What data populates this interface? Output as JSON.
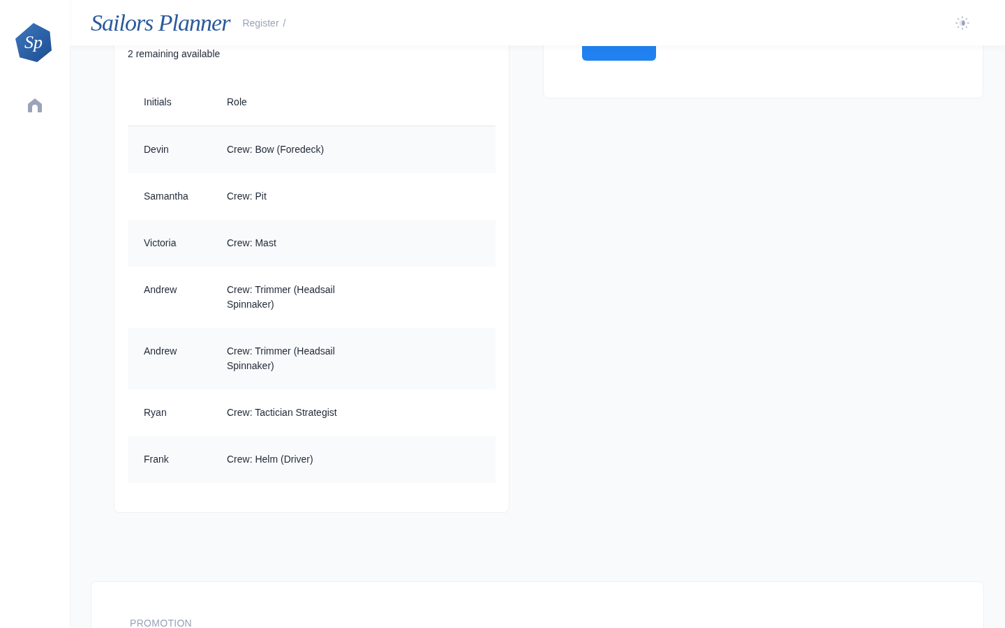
{
  "sidebar": {
    "logo": "Sp",
    "items": [
      {
        "kind": "home",
        "selected": false
      }
    ]
  },
  "header": {
    "brand": "Sailors Planner",
    "breadcrumb": [
      {
        "label": "Register",
        "separator": "/"
      }
    ]
  },
  "crew_card": {
    "remaining": "2 remaining available",
    "table": {
      "columns": [
        "Initials",
        "Role"
      ],
      "rows": [
        [
          "Devin",
          "Crew: Bow (Foredeck)"
        ],
        [
          "Samantha",
          "Crew: Pit"
        ],
        [
          "Victoria",
          "Crew: Mast"
        ],
        [
          "Andrew",
          "Crew: Trimmer (Headsail Spinnaker)"
        ],
        [
          "Andrew",
          "Crew: Trimmer (Headsail Spinnaker)"
        ],
        [
          "Ryan",
          "Crew: Tactician Strategist"
        ],
        [
          "Frank",
          "Crew: Helm (Driver)"
        ]
      ]
    }
  },
  "register_card": {
    "button": {
      "kind": "primary"
    }
  },
  "promotion": {
    "title": "PROMOTION"
  }
}
